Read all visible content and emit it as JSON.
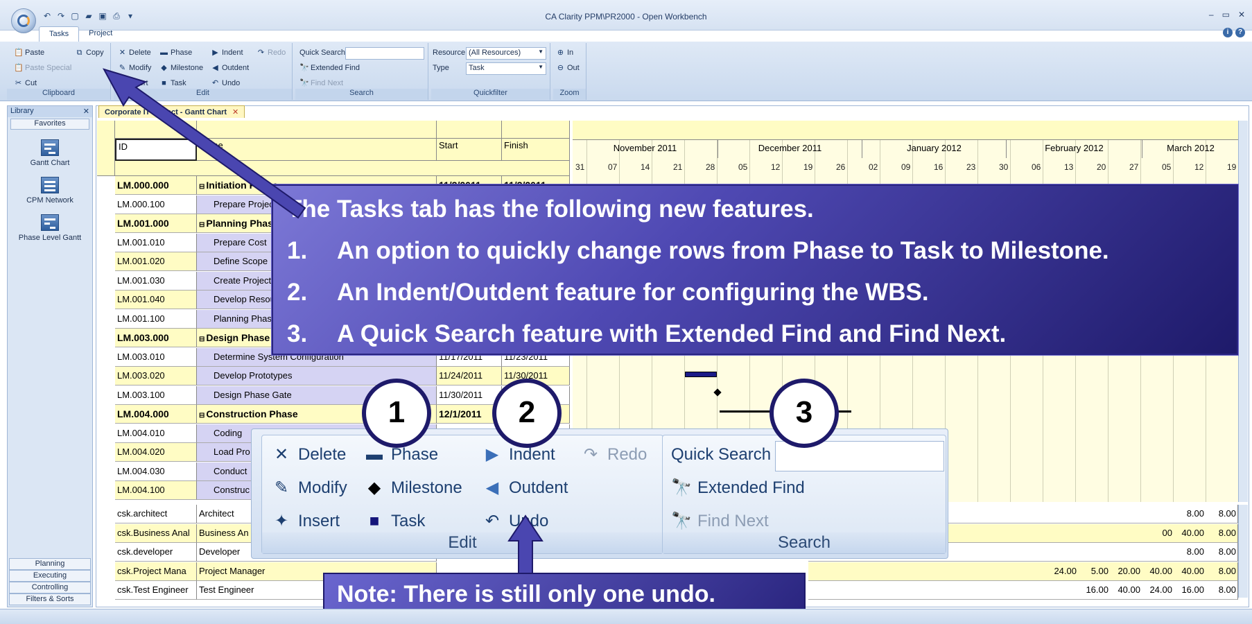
{
  "window": {
    "title": "CA Clarity PPM\\PR2000 - Open Workbench",
    "controls": [
      "–",
      "▭",
      "✕"
    ]
  },
  "ribbon": {
    "tabs": [
      "Tasks",
      "Project"
    ],
    "clipboard": {
      "label": "Clipboard",
      "paste": "Paste",
      "copy": "Copy",
      "paste_special": "Paste Special",
      "cut": "Cut"
    },
    "edit": {
      "label": "Edit",
      "delete": "Delete",
      "phase": "Phase",
      "indent": "Indent",
      "redo": "Redo",
      "modify": "Modify",
      "milestone": "Milestone",
      "outdent": "Outdent",
      "insert": "Insert",
      "task": "Task",
      "undo": "Undo"
    },
    "search": {
      "label": "Search",
      "quick_search": "Quick Search",
      "extended_find": "Extended Find",
      "find_next": "Find Next"
    },
    "quickfilter": {
      "label": "Quickfilter",
      "resource_label": "Resource",
      "resource_value": "(All Resources)",
      "type_label": "Type",
      "type_value": "Task"
    },
    "zoom": {
      "label": "Zoom",
      "in": "In",
      "out": "Out"
    }
  },
  "library": {
    "title": "Library",
    "favorites": "Favorites",
    "items": [
      "Gantt Chart",
      "CPM Network",
      "Phase Level Gantt"
    ],
    "bottom_buttons": [
      "Planning",
      "Executing",
      "Controlling",
      "Filters & Sorts"
    ]
  },
  "document": {
    "tab_label": "Corporate IT Project - Gantt Chart",
    "columns": {
      "id": "ID",
      "name": "Name",
      "start": "Start",
      "finish": "Finish"
    },
    "rows": [
      {
        "id": "LM.000.000",
        "name": "Initiation Phase",
        "start": "11/3/2011",
        "finish": "11/3/2011",
        "bold": true
      },
      {
        "id": "LM.000.100",
        "name": "Prepare Project",
        "start": "",
        "finish": "",
        "bold": false
      },
      {
        "id": "LM.001.000",
        "name": "Planning Phase",
        "start": "",
        "finish": "",
        "bold": true
      },
      {
        "id": "LM.001.010",
        "name": "Prepare Cost",
        "start": "",
        "finish": "",
        "bold": false
      },
      {
        "id": "LM.001.020",
        "name": "Define Scope",
        "start": "",
        "finish": "",
        "bold": false
      },
      {
        "id": "LM.001.030",
        "name": "Create Project",
        "start": "",
        "finish": "",
        "bold": false
      },
      {
        "id": "LM.001.040",
        "name": "Develop Resource",
        "start": "",
        "finish": "",
        "bold": false
      },
      {
        "id": "LM.001.100",
        "name": "Planning Phase",
        "start": "",
        "finish": "",
        "bold": false
      },
      {
        "id": "LM.003.000",
        "name": "Design Phase",
        "start": "",
        "finish": "",
        "bold": true
      },
      {
        "id": "LM.003.010",
        "name": "Determine System Configuration",
        "start": "11/17/2011",
        "finish": "11/23/2011",
        "bold": false
      },
      {
        "id": "LM.003.020",
        "name": "Develop Prototypes",
        "start": "11/24/2011",
        "finish": "11/30/2011",
        "bold": false
      },
      {
        "id": "LM.003.100",
        "name": "Design Phase Gate",
        "start": "11/30/2011",
        "finish": "11/30/2011",
        "bold": false
      },
      {
        "id": "LM.004.000",
        "name": "Construction Phase",
        "start": "12/1/2011",
        "finish": "",
        "bold": true
      },
      {
        "id": "LM.004.010",
        "name": "Coding",
        "start": "",
        "finish": "",
        "bold": false
      },
      {
        "id": "LM.004.020",
        "name": "Load Pro",
        "start": "",
        "finish": "",
        "bold": false
      },
      {
        "id": "LM.004.030",
        "name": "Conduct",
        "start": "",
        "finish": "",
        "bold": false
      },
      {
        "id": "LM.004.100",
        "name": "Construc",
        "start": "",
        "finish": "",
        "bold": false
      }
    ],
    "resources": [
      {
        "id": "csk.architect",
        "name": "Architect",
        "vals": [
          "8.00",
          "8.00"
        ]
      },
      {
        "id": "csk.Business Anal",
        "name": "Business An",
        "vals": [
          "00",
          "40.00",
          "8.00"
        ]
      },
      {
        "id": "csk.developer",
        "name": "Developer",
        "vals": [
          "8.00",
          "8.00"
        ]
      },
      {
        "id": "csk.Project Mana",
        "name": "Project Manager",
        "vals": [
          "24.00",
          "5.00",
          "20.00",
          "40.00",
          "40.00",
          "8.00"
        ]
      },
      {
        "id": "csk.Test Engineer",
        "name": "Test Engineer",
        "vals": [
          "16.00",
          "40.00",
          "24.00",
          "16.00",
          "8.00"
        ]
      }
    ],
    "gantt_months": [
      "November 2011",
      "December 2011",
      "January 2012",
      "February 2012",
      "March 2012"
    ],
    "gantt_days": [
      "31",
      "07",
      "14",
      "21",
      "28",
      "05",
      "12",
      "19",
      "26",
      "02",
      "09",
      "16",
      "23",
      "30",
      "06",
      "13",
      "20",
      "27",
      "05",
      "12",
      "19"
    ]
  },
  "callout": {
    "title": "The Tasks tab has the following new features.",
    "items": [
      {
        "num": "1.",
        "text": "An option to quickly change rows from Phase to Task to Milestone."
      },
      {
        "num": "2.",
        "text": "An Indent/Outdent feature for configuring the WBS."
      },
      {
        "num": "3.",
        "text": "A Quick Search feature with Extended Find and Find Next."
      }
    ]
  },
  "markers": [
    "1",
    "2",
    "3"
  ],
  "note": "Note:  There is still only one undo."
}
